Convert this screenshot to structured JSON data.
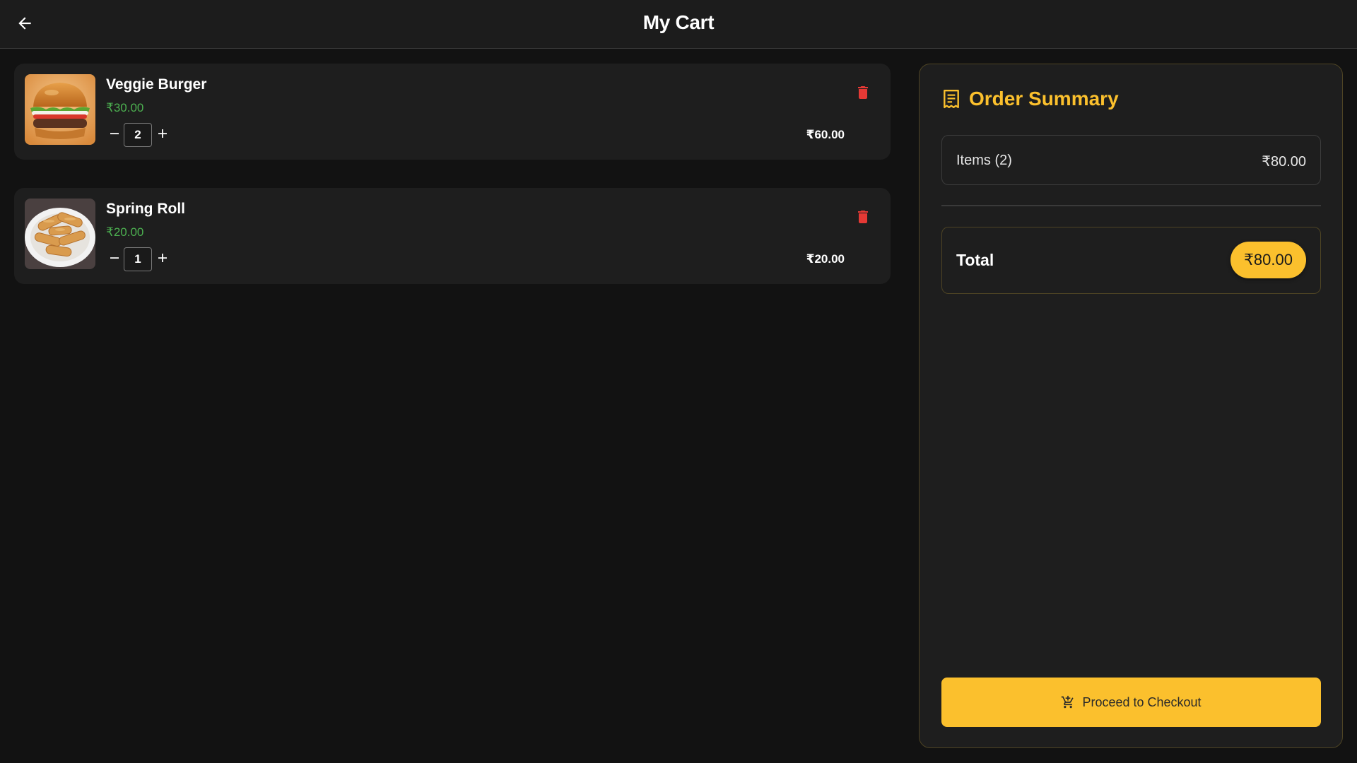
{
  "header": {
    "title": "My Cart",
    "back_icon": "arrow-left-icon"
  },
  "cart": {
    "items": [
      {
        "name": "Veggie Burger",
        "unit_price": "₹30.00",
        "quantity": "2",
        "subtotal": "₹60.00",
        "image": "veggie-burger-image"
      },
      {
        "name": "Spring Roll",
        "unit_price": "₹20.00",
        "quantity": "1",
        "subtotal": "₹20.00",
        "image": "spring-roll-image"
      }
    ]
  },
  "summary": {
    "title": "Order Summary",
    "items_label": "Items (2)",
    "items_value": "₹80.00",
    "total_label": "Total",
    "total_value": "₹80.00",
    "checkout_label": "Proceed to Checkout",
    "icon": "receipt-icon",
    "checkout_icon": "cart-add-icon"
  },
  "colors": {
    "accent": "#fbc02d",
    "price_green": "#4caf50",
    "delete_red": "#e53935",
    "background": "#121212",
    "card": "#1e1e1e"
  }
}
